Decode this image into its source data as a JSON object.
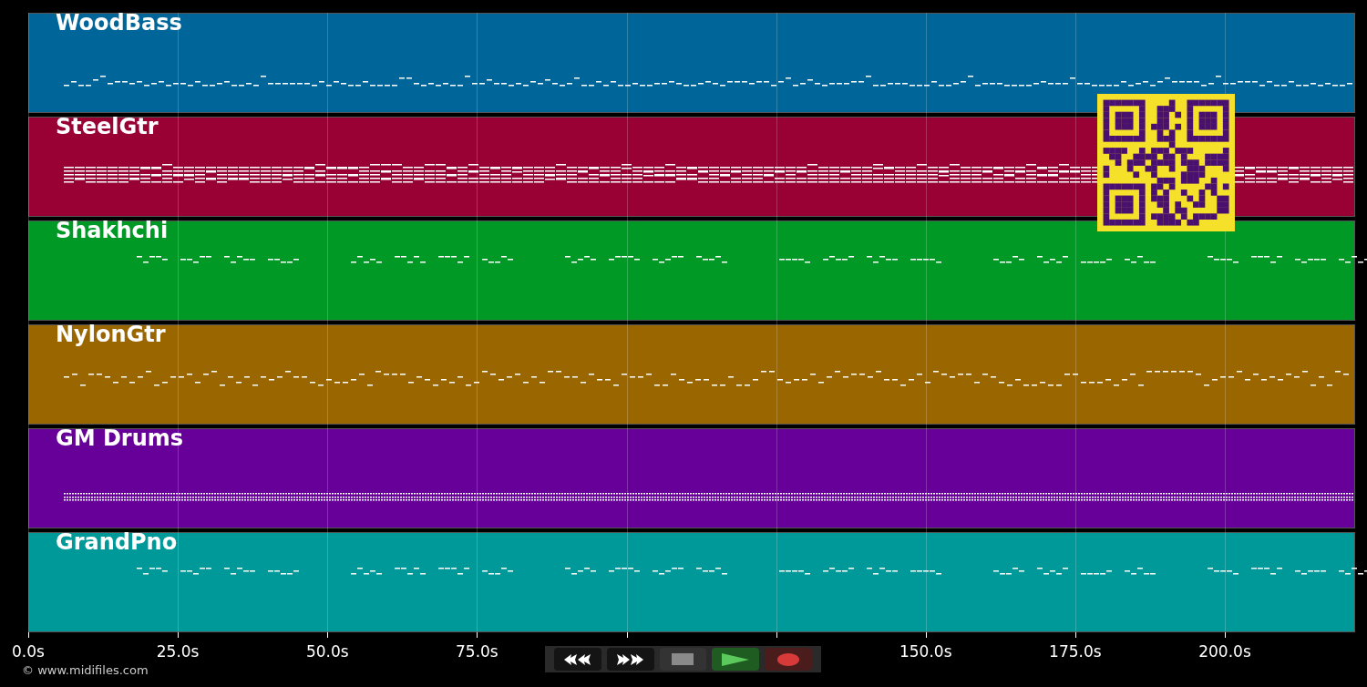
{
  "tracks": [
    {
      "name": "WoodBass",
      "color": "#006699",
      "kind": "bass"
    },
    {
      "name": "SteelGtr",
      "color": "#990033",
      "kind": "chords"
    },
    {
      "name": "Shakhchi",
      "color": "#009926",
      "kind": "melody"
    },
    {
      "name": "NylonGtr",
      "color": "#996600",
      "kind": "arpeggio"
    },
    {
      "name": "GM Drums",
      "color": "#660099",
      "kind": "drums"
    },
    {
      "name": "GrandPno",
      "color": "#009999",
      "kind": "melody"
    }
  ],
  "axis": {
    "tick_labels": [
      "0.0s",
      "25.0s",
      "50.0s",
      "75.0s",
      "150.0s",
      "175.0s",
      "200.0s"
    ]
  },
  "transport": [
    {
      "kind": "rewind"
    },
    {
      "kind": "forward"
    },
    {
      "kind": "stop"
    },
    {
      "kind": "play"
    },
    {
      "kind": "record"
    }
  ],
  "credit": "© www.midifiles.com"
}
